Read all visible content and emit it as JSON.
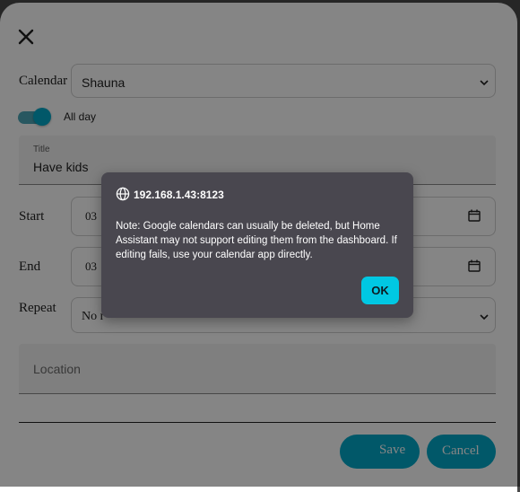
{
  "form": {
    "calendar_label": "Calendar",
    "calendar_value": "Shauna",
    "all_day_label": "All day",
    "all_day_on": true,
    "title_label": "Title",
    "title_value": "Have kids",
    "start_label": "Start",
    "start_date": "03",
    "end_label": "End",
    "end_date": "03",
    "repeat_label": "Repeat",
    "repeat_value": "No r",
    "location_placeholder": "Location"
  },
  "buttons": {
    "save_label": "Save",
    "cancel_label": "Cancel"
  },
  "alert": {
    "origin": "192.168.1.43:8123",
    "message": "Note: Google calendars can usually be deleted, but Home Assistant may not support editing them from the dashboard. If editing fails, use your calendar app directly.",
    "ok_label": "OK"
  },
  "colors": {
    "accent": "#03a9c9",
    "alert_bg": "#49474f",
    "alert_button": "#00c8e3"
  },
  "icons": {
    "close": "close-icon",
    "chevron": "chevron-down-icon",
    "calendar": "calendar-icon",
    "globe": "globe-icon"
  }
}
